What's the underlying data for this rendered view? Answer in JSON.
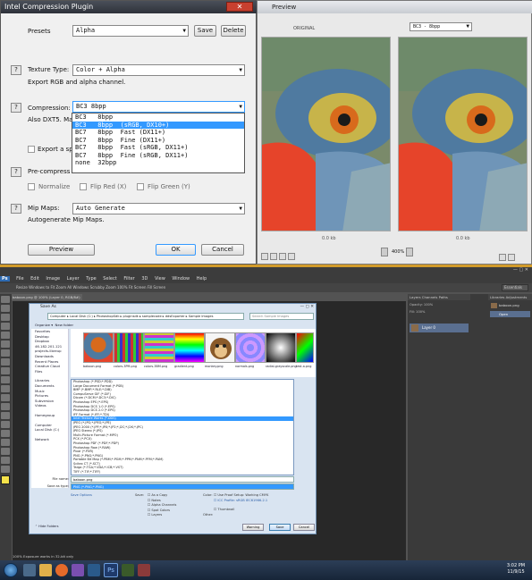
{
  "plugin": {
    "title": "Intel Compression Plugin",
    "close_label": "✕",
    "presets_label": "Presets",
    "presets_value": "Alpha",
    "save_label": "Save",
    "delete_label": "Delete",
    "help_label": "?",
    "texture_type_label": "Texture Type:",
    "texture_type_value": "Color + Alpha",
    "texture_desc": "Export RGB and alpha channel.",
    "compression_label": "Compression:",
    "compression_value": "BC3   8bpp",
    "compression_desc": "Also DXT5. Maxi",
    "compression_options": [
      "BC3   8bpp",
      "BC3   8bpp  (sRGB, DX10+)",
      "BC7   8bpp  Fast (DX11+)",
      "BC7   8bpp  Fine (DX11+)",
      "BC7   8bpp  Fast (sRGB, DX11+)",
      "BC7   8bpp  Fine (sRGB, DX11+)",
      "none  32bpp"
    ],
    "export_alpha_label": "Export a spe",
    "precompress_label": "Pre-compress No",
    "normalize_label": "Normalize",
    "flip_red_label": "Flip Red (X)",
    "flip_green_label": "Flip Green (Y)",
    "mipmaps_label": "Mip Maps:",
    "mipmaps_value": "Auto Generate",
    "mipmaps_desc": "Autogenerate Mip Maps.",
    "preview_label": "Preview",
    "ok_label": "OK",
    "cancel_label": "Cancel"
  },
  "preview": {
    "title": "Preview",
    "left_label": "ORIGINAL",
    "right_label": "BC3 - 8bpp",
    "left_caption": "0.0 kb",
    "right_caption": "0.0 kb",
    "zoom": "400%"
  },
  "photoshop": {
    "logo": "Ps",
    "menu": [
      "File",
      "Edit",
      "Image",
      "Layer",
      "Type",
      "Select",
      "Filter",
      "3D",
      "View",
      "Window",
      "Help"
    ],
    "options_text": "Resize Windows to Fit   Zoom All Windows   Scrubby Zoom   100%   Fit Screen   Fill Screen",
    "doc_tab": "baboon.png @ 100% (Layer 0, RGB/8#)",
    "workspace": "Essentials",
    "layers_tab": "Layers",
    "channels_tab": "Channels",
    "paths_tab": "Paths",
    "layer_name": "Layer 0",
    "libraries_tab": "Libraries",
    "adjust_tab": "Adjustments",
    "file_name": "baboon.png",
    "history_item": "Open",
    "opacity_label": "Opacity: 100%",
    "fill_label": "Fill: 100%",
    "status_text": "100%   Exposure works in 32-bit only"
  },
  "save_dialog": {
    "title": "Save As",
    "breadcrumb": "Computer ▸ Local Disk (C:) ▸ PhotoshopSdk ▸ pluginsdk ▸ samplecode ▸ ddsExporter ▸ Sample Images",
    "search_placeholder": "Search Sample Images",
    "organize_label": "Organize ▾",
    "new_folder_label": "New folder",
    "nav_items": [
      "Favorites",
      "Desktop",
      "Dropbox",
      "46.182.201.121",
      "projects.libreup",
      "Downloads",
      "Recent Places",
      "Creative Cloud Files",
      "Libraries",
      "Documents",
      "Music",
      "Pictures",
      "Subversion",
      "Videos",
      "Homegroup",
      "Computer",
      "Local Disk (C:)",
      "Network"
    ],
    "thumbnails": [
      "baboon.png",
      "colors-3PM.png",
      "colors-3BM.png",
      "gradient.png",
      "monkey.png",
      "normals.png",
      "radial-grayscale.png",
      "test-a.png"
    ],
    "formats": [
      "Photoshop (*.PSD;*.PDD)",
      "Large Document Format (*.PSB)",
      "BMP (*.BMP;*.RLE;*.DIB)",
      "CompuServe GIF (*.GIF)",
      "Dicom (*.DCM;*.DC3;*.DIC)",
      "Photoshop EPS (*.EPS)",
      "Photoshop DCS 1.0 (*.EPS)",
      "Photoshop DCS 2.0 (*.EPS)",
      "IFF Format (*.IFF;*.TDI)",
      "Intel Texture Works (*.DDS)",
      "JPEG (*.JPG;*.JPEG;*.JPE)",
      "JPEG 2000 (*.JPF;*.JPX;*.JP2;*.J2C;*.J2K;*.JPC)",
      "JPEG Stereo (*.JPS)",
      "Multi-Picture Format (*.MPO)",
      "PCX (*.PCX)",
      "Photoshop PDF (*.PDF;*.PDP)",
      "Photoshop Raw (*.RAW)",
      "Pixar (*.PXR)",
      "PNG (*.PNG;*.PNG)",
      "Portable Bit Map (*.PBM;*.PGM;*.PPM;*.PNM;*.PFM;*.PAM)",
      "Scitex CT (*.SCT)",
      "Targa (*.TGA;*.VDA;*.ICB;*.VST)",
      "TIFF (*.TIF;*.TIFF)"
    ],
    "filename_label": "File name:",
    "filename_value": "baboon.png",
    "saveas_label": "Save as type:",
    "saveas_value": "PNG (*.PNG;*.PNG)",
    "save_options_label": "Save Options",
    "save_label": "Save:",
    "as_copy_label": "As a Copy",
    "notes_label": "Notes",
    "alpha_channels_label": "Alpha Channels",
    "spot_colors_label": "Spot Colors",
    "layers_label": "Layers",
    "color_label": "Color:",
    "use_proof_label": "Use Proof Setup: Working CMYK",
    "icc_label": "ICC Profile: sRGB IEC61966-2.1",
    "other_label": "Other:",
    "thumbnail_label": "Thumbnail",
    "warning_label": "Warning",
    "save_button": "Save",
    "cancel_button": "Cancel",
    "hide_folders": "Hide Folders"
  },
  "taskbar": {
    "time": "3:02 PM",
    "date": "11/9/15"
  }
}
